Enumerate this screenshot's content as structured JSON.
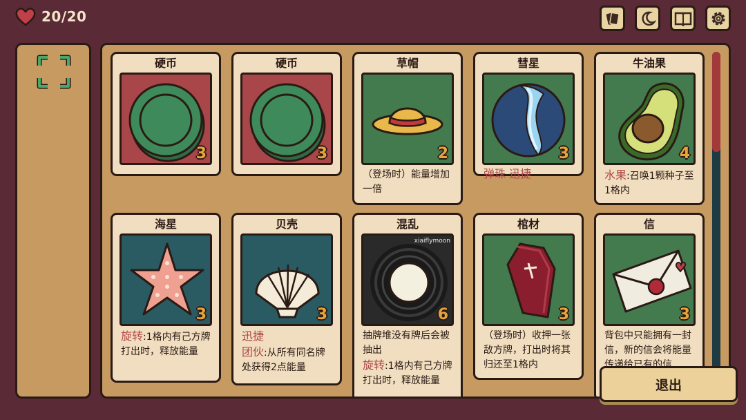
{
  "hud": {
    "hp_text": "20/20"
  },
  "toolbar": {
    "icons": [
      "cards-icon",
      "moon-icon",
      "book-icon",
      "gear-icon"
    ]
  },
  "cards": [
    {
      "name": "硬币",
      "cost": "3",
      "art": "coin"
    },
    {
      "name": "硬币",
      "cost": "3",
      "art": "coin"
    },
    {
      "name": "草帽",
      "cost": "2",
      "art": "straw-hat",
      "desc": "（登场时）能量增加一倍"
    },
    {
      "name": "彗星",
      "cost": "3",
      "art": "marble",
      "keyword": "弹珠 迅捷"
    },
    {
      "name": "牛油果",
      "cost": "4",
      "art": "avocado",
      "keyword": "水果",
      "desc": ":召唤1颗种子至1格内"
    },
    {
      "name": "海星",
      "cost": "3",
      "art": "starfish",
      "keyword": "旋转",
      "desc": ":1格内有己方牌打出时，释放能量"
    },
    {
      "name": "贝壳",
      "cost": "3",
      "art": "shell",
      "keyword": "迅捷",
      "keyword2": "团伙",
      "desc": ":从所有同名牌处获得2点能量"
    },
    {
      "name": "混乱",
      "cost": "6",
      "art": "chaos",
      "watermark": "xiaiflymoon",
      "desc_pre": "抽牌堆没有牌后会被抽出",
      "keyword": "旋转",
      "desc": ":1格内有己方牌打出时，释放能量"
    },
    {
      "name": "棺材",
      "cost": "3",
      "art": "coffin",
      "desc": "（登场时）收押一张敌方牌，打出时将其归还至1格内"
    },
    {
      "name": "信",
      "cost": "3",
      "art": "letter",
      "desc": "背包中只能拥有一封信，新的信会将能量传递给已有的信"
    }
  ],
  "exit_label": "退出",
  "colors": {
    "background": "#5a2a36",
    "panel": "#c79a62",
    "card": "#f1dec0",
    "keyword": "#b04848",
    "cost": "#e8a43a"
  }
}
